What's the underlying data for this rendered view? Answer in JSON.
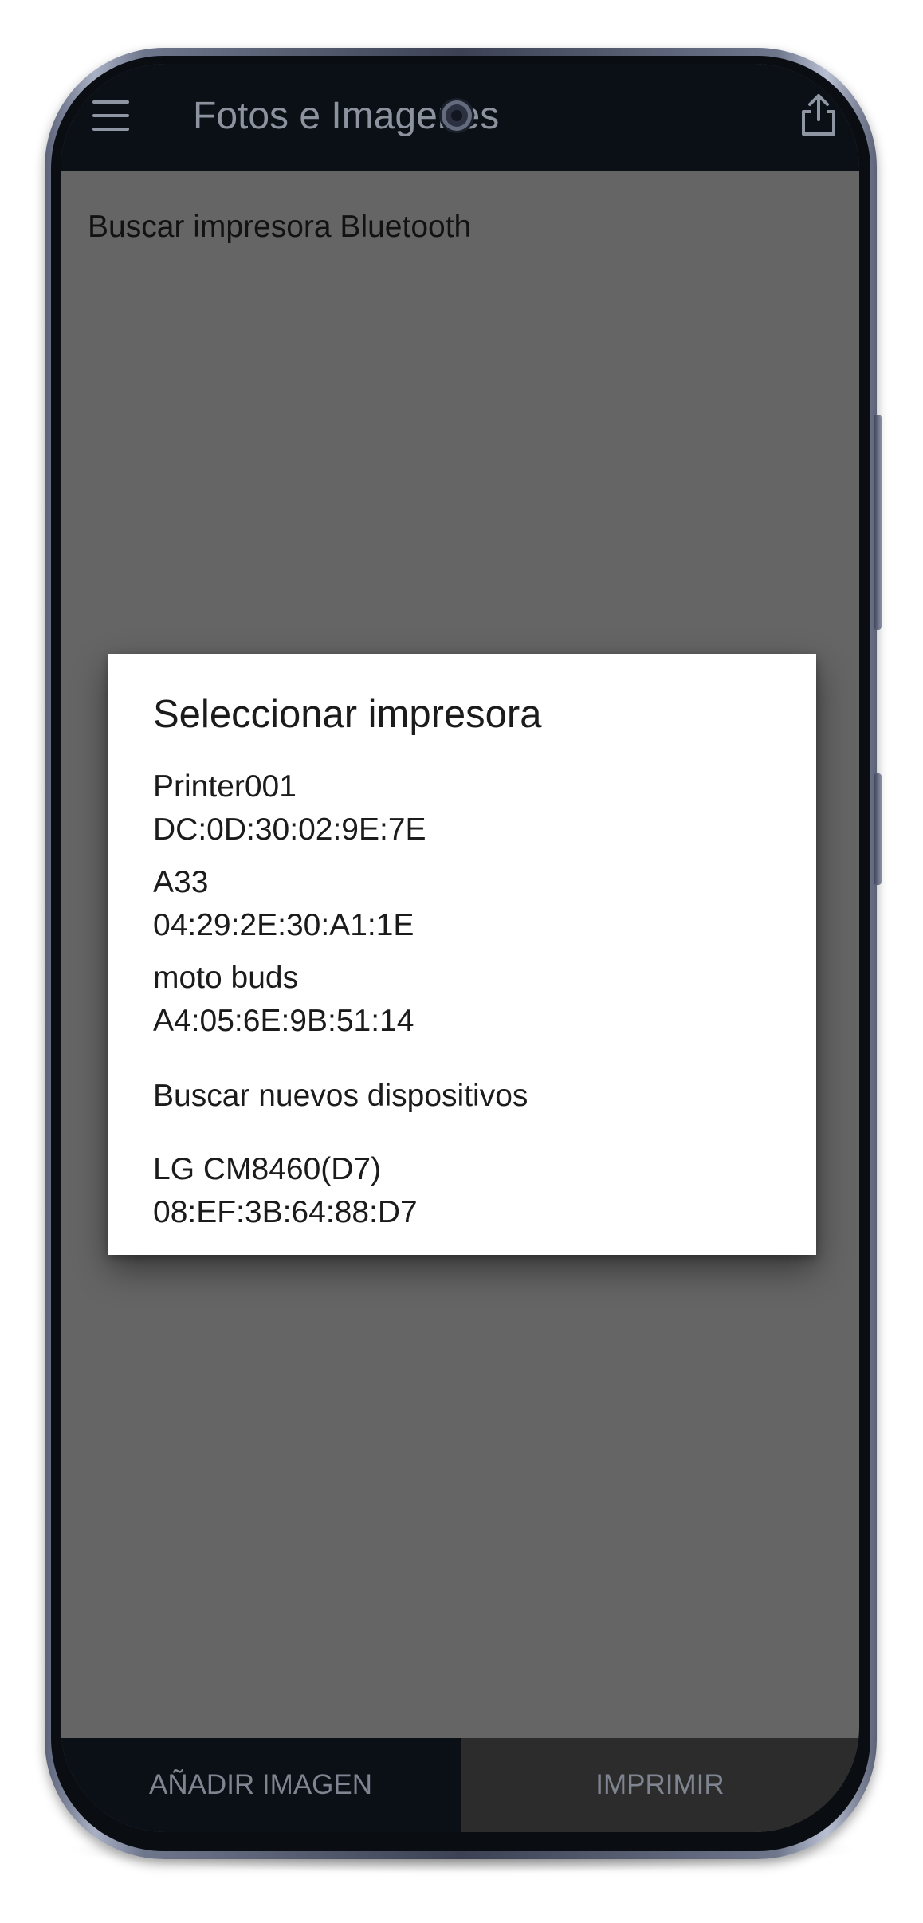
{
  "app_bar": {
    "title": "Fotos e Imagenes",
    "menu_icon": "hamburger-menu-icon",
    "share_icon": "share-icon"
  },
  "main": {
    "search_bluetooth_label": "Buscar impresora Bluetooth"
  },
  "dialog": {
    "title": "Seleccionar impresora",
    "devices": [
      {
        "name": "Printer001",
        "address": "DC:0D:30:02:9E:7E"
      },
      {
        "name": "A33",
        "address": "04:29:2E:30:A1:1E"
      },
      {
        "name": "moto buds",
        "address": "A4:05:6E:9B:51:14"
      },
      {
        "name": "LG CM8460(D7)",
        "address": "08:EF:3B:64:88:D7"
      }
    ],
    "scan_new_devices_label": "Buscar nuevos dispositivos"
  },
  "bottom_bar": {
    "add_image_label": "AÑADIR IMAGEN",
    "print_label": "IMPRIMIR"
  },
  "colors": {
    "app_bar_bg": "#0b1016",
    "scrim": "#656565",
    "dialog_bg": "#ffffff",
    "print_button_bg": "#2c2c2c"
  }
}
